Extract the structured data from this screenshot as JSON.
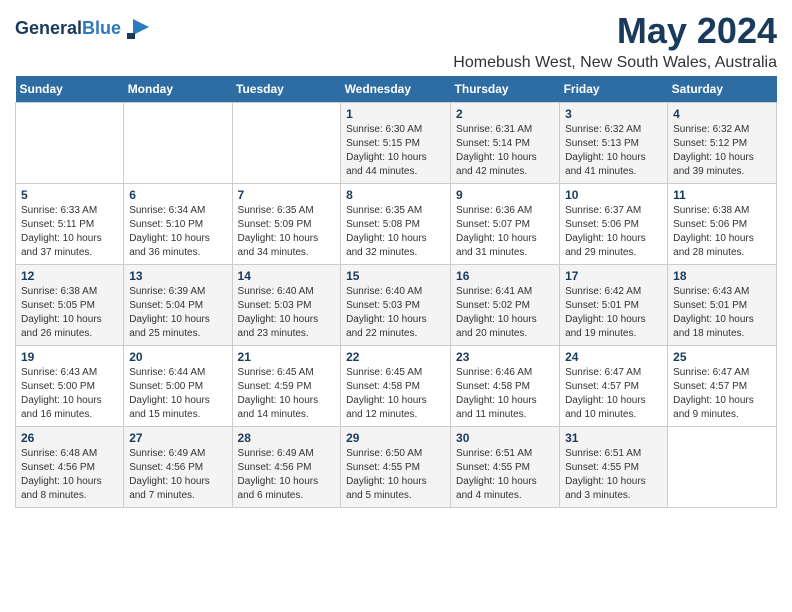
{
  "logo": {
    "line1": "General",
    "line2": "Blue"
  },
  "title": "May 2024",
  "subtitle": "Homebush West, New South Wales, Australia",
  "days_of_week": [
    "Sunday",
    "Monday",
    "Tuesday",
    "Wednesday",
    "Thursday",
    "Friday",
    "Saturday"
  ],
  "weeks": [
    [
      {
        "num": "",
        "detail": ""
      },
      {
        "num": "",
        "detail": ""
      },
      {
        "num": "",
        "detail": ""
      },
      {
        "num": "1",
        "detail": "Sunrise: 6:30 AM\nSunset: 5:15 PM\nDaylight: 10 hours\nand 44 minutes."
      },
      {
        "num": "2",
        "detail": "Sunrise: 6:31 AM\nSunset: 5:14 PM\nDaylight: 10 hours\nand 42 minutes."
      },
      {
        "num": "3",
        "detail": "Sunrise: 6:32 AM\nSunset: 5:13 PM\nDaylight: 10 hours\nand 41 minutes."
      },
      {
        "num": "4",
        "detail": "Sunrise: 6:32 AM\nSunset: 5:12 PM\nDaylight: 10 hours\nand 39 minutes."
      }
    ],
    [
      {
        "num": "5",
        "detail": "Sunrise: 6:33 AM\nSunset: 5:11 PM\nDaylight: 10 hours\nand 37 minutes."
      },
      {
        "num": "6",
        "detail": "Sunrise: 6:34 AM\nSunset: 5:10 PM\nDaylight: 10 hours\nand 36 minutes."
      },
      {
        "num": "7",
        "detail": "Sunrise: 6:35 AM\nSunset: 5:09 PM\nDaylight: 10 hours\nand 34 minutes."
      },
      {
        "num": "8",
        "detail": "Sunrise: 6:35 AM\nSunset: 5:08 PM\nDaylight: 10 hours\nand 32 minutes."
      },
      {
        "num": "9",
        "detail": "Sunrise: 6:36 AM\nSunset: 5:07 PM\nDaylight: 10 hours\nand 31 minutes."
      },
      {
        "num": "10",
        "detail": "Sunrise: 6:37 AM\nSunset: 5:06 PM\nDaylight: 10 hours\nand 29 minutes."
      },
      {
        "num": "11",
        "detail": "Sunrise: 6:38 AM\nSunset: 5:06 PM\nDaylight: 10 hours\nand 28 minutes."
      }
    ],
    [
      {
        "num": "12",
        "detail": "Sunrise: 6:38 AM\nSunset: 5:05 PM\nDaylight: 10 hours\nand 26 minutes."
      },
      {
        "num": "13",
        "detail": "Sunrise: 6:39 AM\nSunset: 5:04 PM\nDaylight: 10 hours\nand 25 minutes."
      },
      {
        "num": "14",
        "detail": "Sunrise: 6:40 AM\nSunset: 5:03 PM\nDaylight: 10 hours\nand 23 minutes."
      },
      {
        "num": "15",
        "detail": "Sunrise: 6:40 AM\nSunset: 5:03 PM\nDaylight: 10 hours\nand 22 minutes."
      },
      {
        "num": "16",
        "detail": "Sunrise: 6:41 AM\nSunset: 5:02 PM\nDaylight: 10 hours\nand 20 minutes."
      },
      {
        "num": "17",
        "detail": "Sunrise: 6:42 AM\nSunset: 5:01 PM\nDaylight: 10 hours\nand 19 minutes."
      },
      {
        "num": "18",
        "detail": "Sunrise: 6:43 AM\nSunset: 5:01 PM\nDaylight: 10 hours\nand 18 minutes."
      }
    ],
    [
      {
        "num": "19",
        "detail": "Sunrise: 6:43 AM\nSunset: 5:00 PM\nDaylight: 10 hours\nand 16 minutes."
      },
      {
        "num": "20",
        "detail": "Sunrise: 6:44 AM\nSunset: 5:00 PM\nDaylight: 10 hours\nand 15 minutes."
      },
      {
        "num": "21",
        "detail": "Sunrise: 6:45 AM\nSunset: 4:59 PM\nDaylight: 10 hours\nand 14 minutes."
      },
      {
        "num": "22",
        "detail": "Sunrise: 6:45 AM\nSunset: 4:58 PM\nDaylight: 10 hours\nand 12 minutes."
      },
      {
        "num": "23",
        "detail": "Sunrise: 6:46 AM\nSunset: 4:58 PM\nDaylight: 10 hours\nand 11 minutes."
      },
      {
        "num": "24",
        "detail": "Sunrise: 6:47 AM\nSunset: 4:57 PM\nDaylight: 10 hours\nand 10 minutes."
      },
      {
        "num": "25",
        "detail": "Sunrise: 6:47 AM\nSunset: 4:57 PM\nDaylight: 10 hours\nand 9 minutes."
      }
    ],
    [
      {
        "num": "26",
        "detail": "Sunrise: 6:48 AM\nSunset: 4:56 PM\nDaylight: 10 hours\nand 8 minutes."
      },
      {
        "num": "27",
        "detail": "Sunrise: 6:49 AM\nSunset: 4:56 PM\nDaylight: 10 hours\nand 7 minutes."
      },
      {
        "num": "28",
        "detail": "Sunrise: 6:49 AM\nSunset: 4:56 PM\nDaylight: 10 hours\nand 6 minutes."
      },
      {
        "num": "29",
        "detail": "Sunrise: 6:50 AM\nSunset: 4:55 PM\nDaylight: 10 hours\nand 5 minutes."
      },
      {
        "num": "30",
        "detail": "Sunrise: 6:51 AM\nSunset: 4:55 PM\nDaylight: 10 hours\nand 4 minutes."
      },
      {
        "num": "31",
        "detail": "Sunrise: 6:51 AM\nSunset: 4:55 PM\nDaylight: 10 hours\nand 3 minutes."
      },
      {
        "num": "",
        "detail": ""
      }
    ]
  ]
}
